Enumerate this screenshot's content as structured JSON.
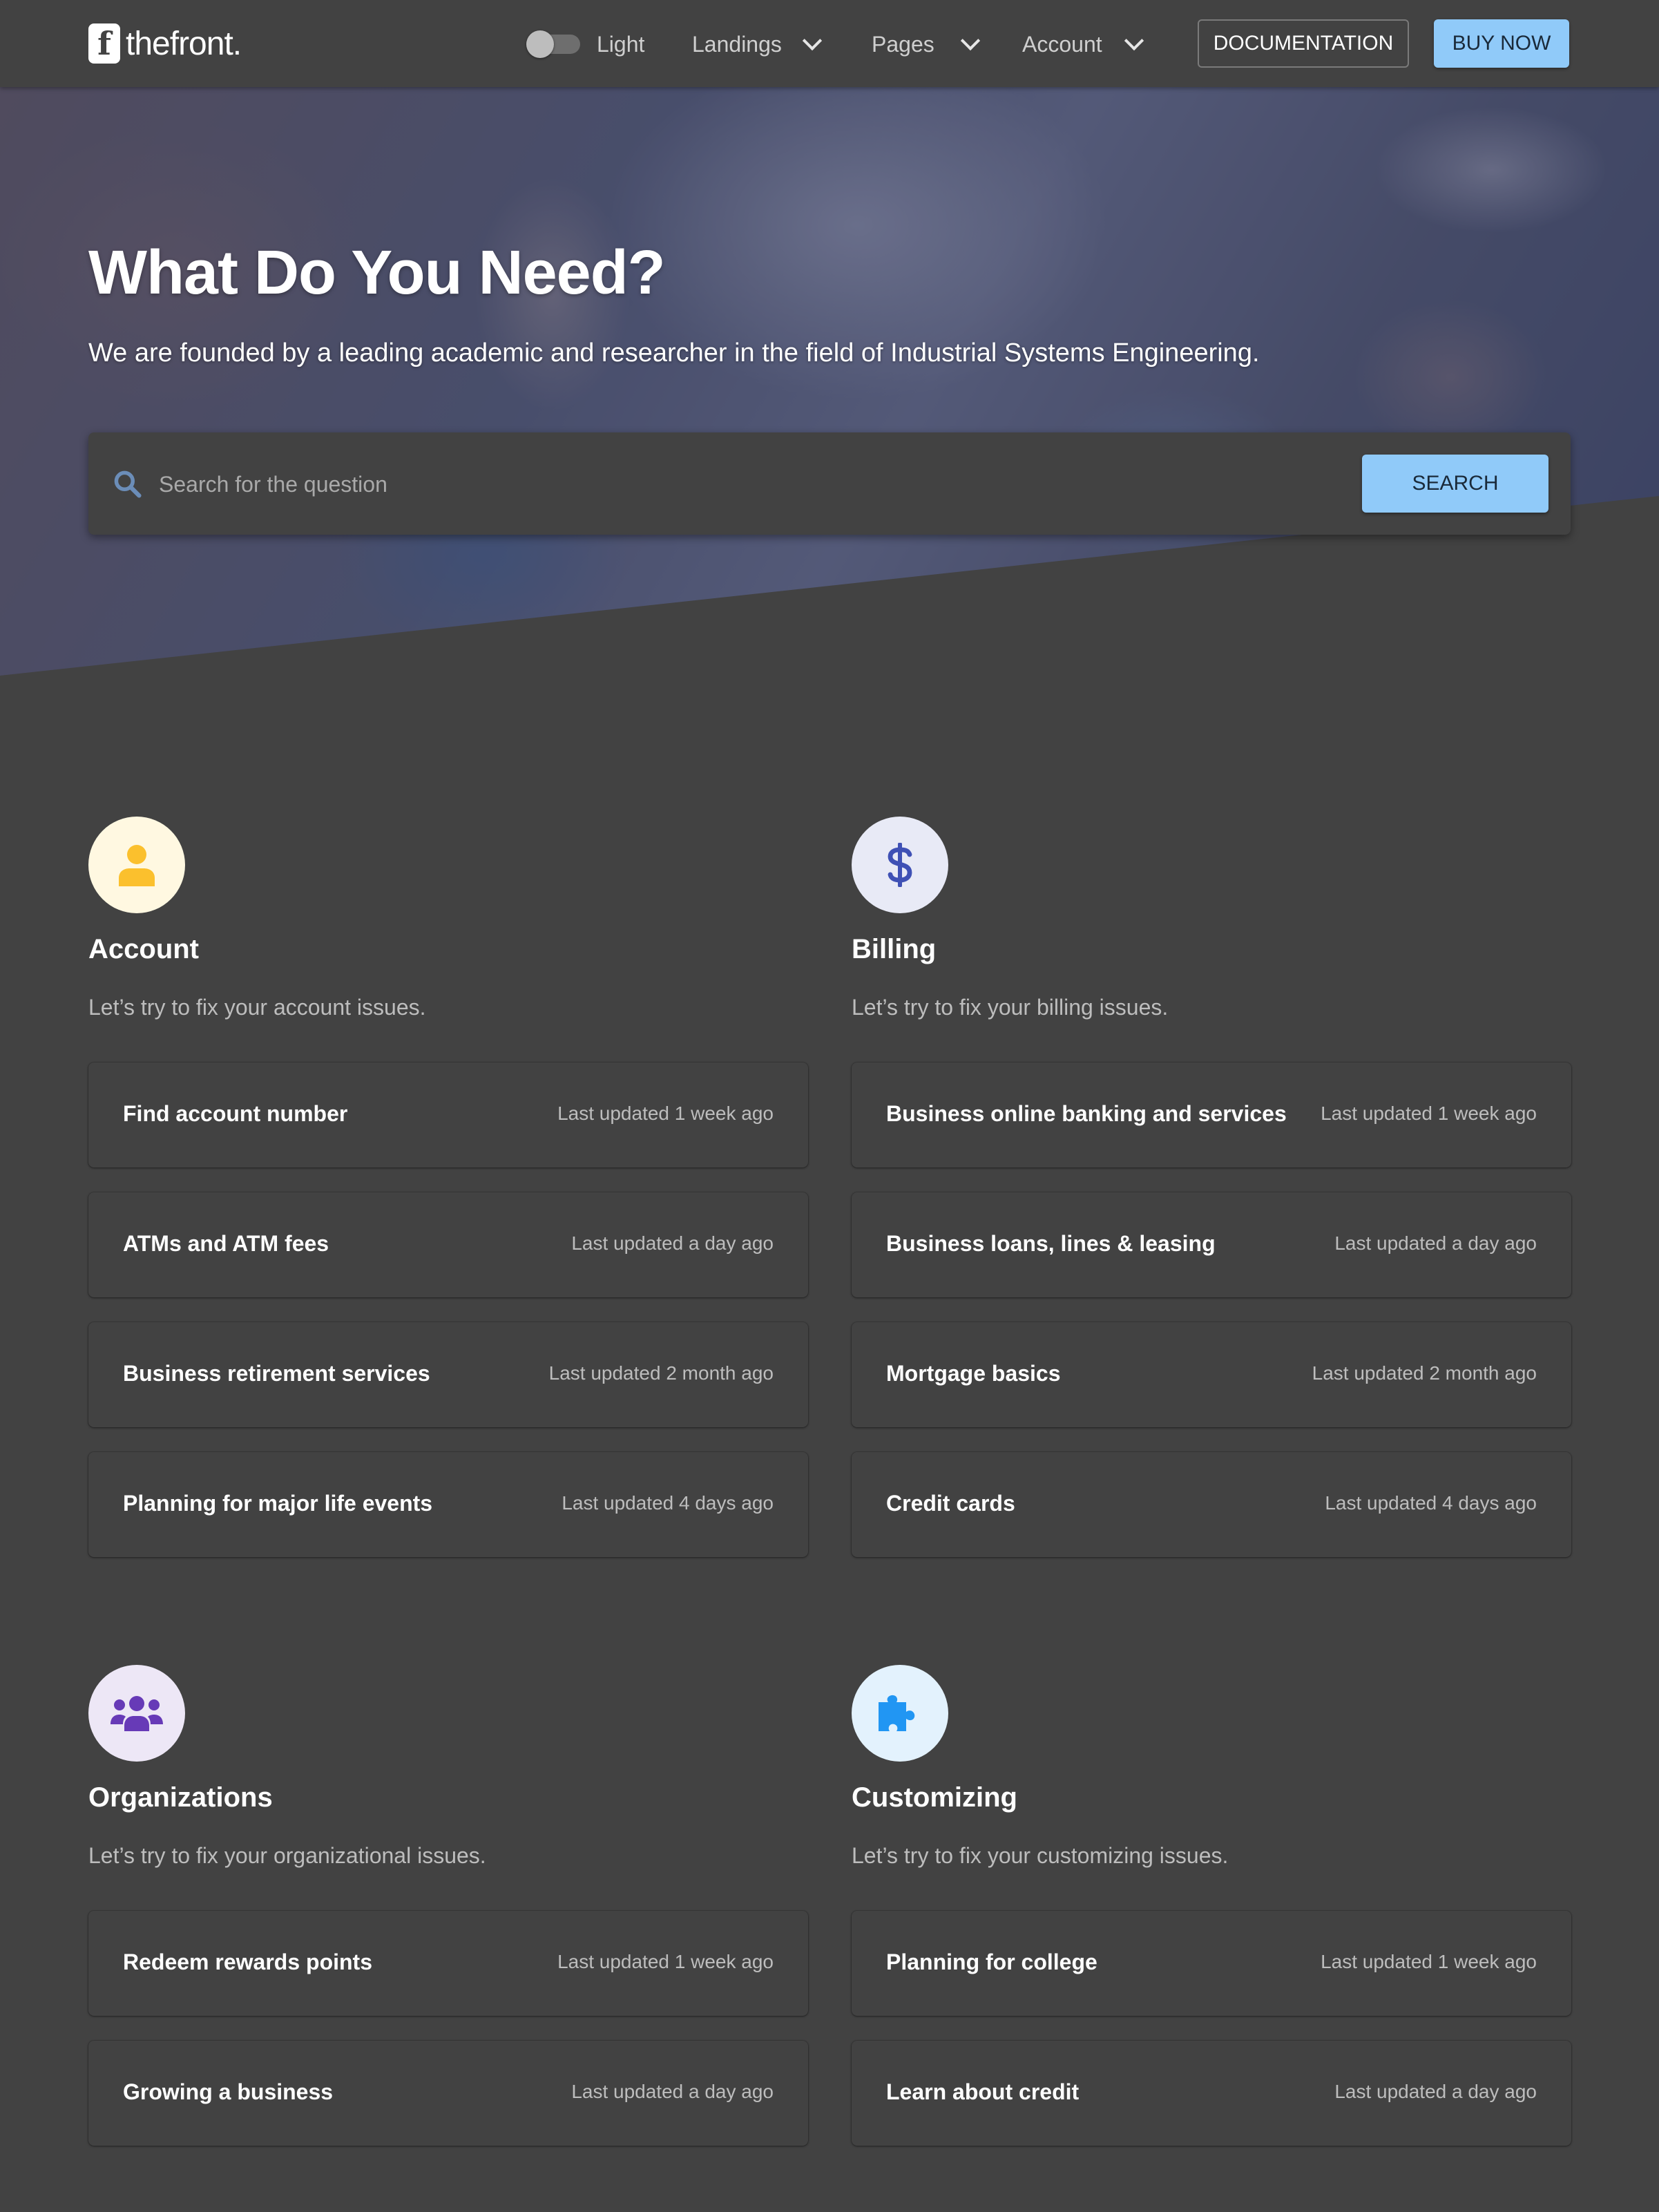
{
  "brand": {
    "mark": "f",
    "name": "thefront."
  },
  "nav": {
    "theme_label": "Light",
    "items": [
      {
        "label": "Landings"
      },
      {
        "label": "Pages"
      },
      {
        "label": "Account"
      }
    ],
    "documentation_label": "DOCUMENTATION",
    "buy_label": "BUY NOW"
  },
  "hero": {
    "title": "What Do You Need?",
    "subtitle": "We are founded by a leading academic and researcher in the field of Industrial Systems Engineering.",
    "search": {
      "placeholder": "Search for the question",
      "button_label": "SEARCH"
    }
  },
  "colors": {
    "accent": "#90caf9",
    "background": "#424242",
    "account_icon_bg": "#fff8e1",
    "account_icon": "#fbc02d",
    "billing_icon_bg": "#e8eaf6",
    "billing_icon": "#3f51b5",
    "organizations_icon_bg": "#ede7f6",
    "organizations_icon": "#673ab7",
    "customizing_icon_bg": "#e3f2fd",
    "customizing_icon": "#2196f3"
  },
  "categories": [
    {
      "icon": "user-icon",
      "title": "Account",
      "description": "Let’s try to fix your account issues.",
      "items": [
        {
          "title": "Find account number",
          "updated": "Last updated 1 week ago"
        },
        {
          "title": "ATMs and ATM fees",
          "updated": "Last updated a day ago"
        },
        {
          "title": "Business retirement services",
          "updated": "Last updated 2 month ago"
        },
        {
          "title": "Planning for major life events",
          "updated": "Last updated 4 days ago"
        }
      ]
    },
    {
      "icon": "dollar-icon",
      "title": "Billing",
      "description": "Let’s try to fix your billing issues.",
      "items": [
        {
          "title": "Business online banking and services",
          "updated": "Last updated 1 week ago"
        },
        {
          "title": "Business loans, lines & leasing",
          "updated": "Last updated a day ago"
        },
        {
          "title": "Mortgage basics",
          "updated": "Last updated 2 month ago"
        },
        {
          "title": "Credit cards",
          "updated": "Last updated 4 days ago"
        }
      ]
    },
    {
      "icon": "users-icon",
      "title": "Organizations",
      "description": "Let’s try to fix your organizational issues.",
      "items": [
        {
          "title": "Redeem rewards points",
          "updated": "Last updated 1 week ago"
        },
        {
          "title": "Growing a business",
          "updated": "Last updated a day ago"
        }
      ]
    },
    {
      "icon": "puzzle-icon",
      "title": "Customizing",
      "description": "Let’s try to fix your customizing issues.",
      "items": [
        {
          "title": "Planning for college",
          "updated": "Last updated 1 week ago"
        },
        {
          "title": "Learn about credit",
          "updated": "Last updated a day ago"
        }
      ]
    }
  ]
}
